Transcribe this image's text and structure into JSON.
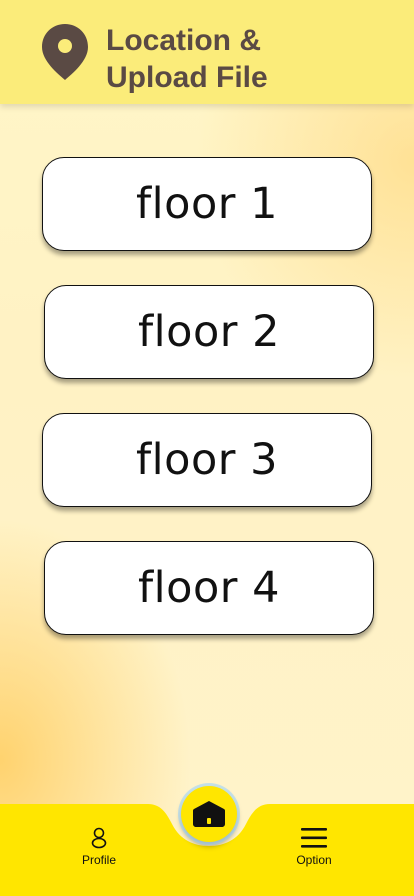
{
  "header": {
    "title_line1": "Location &",
    "title_line2": "Upload File",
    "icon": "location-pin-icon"
  },
  "floors": [
    {
      "label": "floor 1"
    },
    {
      "label": "floor 2"
    },
    {
      "label": "floor 3"
    },
    {
      "label": "floor 4"
    }
  ],
  "bottom_nav": {
    "profile_label": "Profile",
    "profile_icon": "person-icon",
    "home_icon": "home-icon",
    "option_label": "Option",
    "option_icon": "menu-icon"
  },
  "colors": {
    "header_bg": "#fbec7a",
    "nav_bg": "#ffe600",
    "title_text": "#5a4a44",
    "pin": "#5a4a44"
  }
}
